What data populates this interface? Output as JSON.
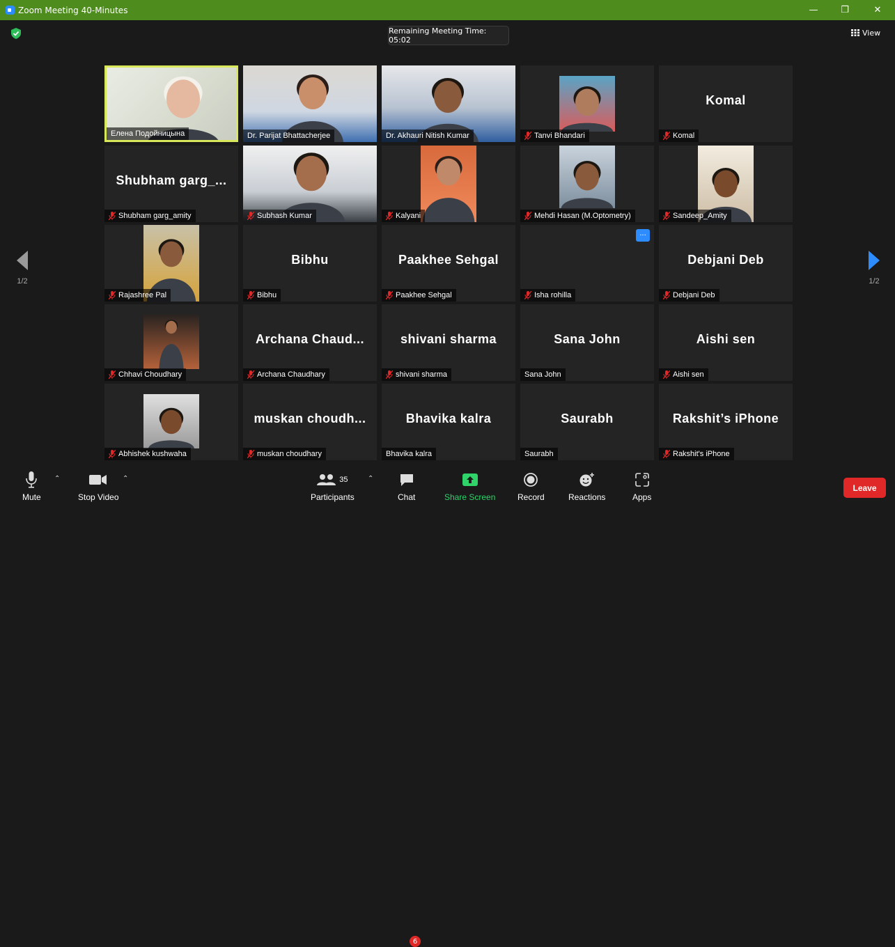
{
  "window": {
    "title": "Zoom Meeting 40-Minutes",
    "controls": {
      "minimize": "—",
      "restore": "❐",
      "close": "✕"
    }
  },
  "meeting": {
    "remaining_time": "Remaining Meeting Time: 05:02",
    "view_label": "View"
  },
  "pagination": {
    "left": "1/2",
    "right": "1/2"
  },
  "tiles": [
    {
      "label": "Елена Подойницына",
      "muted": false,
      "display": ""
    },
    {
      "label": "Dr. Parijat Bhattacherjee",
      "muted": false,
      "display": ""
    },
    {
      "label": "Dr. Akhauri Nitish Kumar",
      "muted": false,
      "display": ""
    },
    {
      "label": "Tanvi Bhandari",
      "muted": true,
      "display": ""
    },
    {
      "label": "Komal",
      "muted": true,
      "display": "Komal"
    },
    {
      "label": "Shubham garg_amity",
      "muted": true,
      "display": "Shubham garg_..."
    },
    {
      "label": "Subhash Kumar",
      "muted": true,
      "display": ""
    },
    {
      "label": "Kalyani",
      "muted": true,
      "display": ""
    },
    {
      "label": "Mehdi Hasan (M.Optometry)",
      "muted": true,
      "display": ""
    },
    {
      "label": "Sandeep_Amity",
      "muted": true,
      "display": ""
    },
    {
      "label": "Rajashree Pal",
      "muted": true,
      "display": ""
    },
    {
      "label": "Bibhu",
      "muted": true,
      "display": "Bibhu"
    },
    {
      "label": "Paakhee Sehgal",
      "muted": true,
      "display": "Paakhee Sehgal"
    },
    {
      "label": "Isha rohilla",
      "muted": true,
      "display": "",
      "more": "···"
    },
    {
      "label": "Debjani Deb",
      "muted": true,
      "display": "Debjani Deb"
    },
    {
      "label": "Chhavi Choudhary",
      "muted": true,
      "display": ""
    },
    {
      "label": "Archana Chaudhary",
      "muted": true,
      "display": "Archana Chaud..."
    },
    {
      "label": "shivani sharma",
      "muted": true,
      "display": "shivani sharma"
    },
    {
      "label": "Sana John",
      "muted": false,
      "display": "Sana John"
    },
    {
      "label": "Aishi sen",
      "muted": true,
      "display": "Aishi sen"
    },
    {
      "label": "Abhishek kushwaha",
      "muted": true,
      "display": ""
    },
    {
      "label": "muskan choudhary",
      "muted": true,
      "display": "muskan choudh..."
    },
    {
      "label": "Bhavika kalra",
      "muted": false,
      "display": "Bhavika kalra"
    },
    {
      "label": "Saurabh",
      "muted": false,
      "display": "Saurabh"
    },
    {
      "label": "Rakshit's iPhone",
      "muted": true,
      "display": "Rakshit’s iPhone"
    }
  ],
  "toolbar": {
    "mute": "Mute",
    "stop_video": "Stop Video",
    "participants": "Participants",
    "participants_count": "35",
    "chat": "Chat",
    "chat_badge": "6",
    "share_screen": "Share Screen",
    "record": "Record",
    "reactions": "Reactions",
    "apps": "Apps",
    "leave": "Leave"
  },
  "colors": {
    "titlebar": "#4e8c1e",
    "background": "#1a1a1a",
    "tile": "#242424",
    "active_speaker": "#d8e85a",
    "share_green": "#2fd36a",
    "leave_red": "#e02828",
    "accent_blue": "#2d8cff"
  }
}
